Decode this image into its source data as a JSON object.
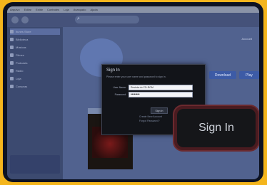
{
  "menubar": [
    "Arquivo",
    "Editar",
    "Exibir",
    "Controles",
    "Loja",
    "Avançado",
    "Ajuda"
  ],
  "sidebar": {
    "items": [
      {
        "label": "Itunes Store",
        "active": true
      },
      {
        "label": "Biblioteca",
        "active": false
      },
      {
        "label": "Músicas",
        "active": false
      },
      {
        "label": "Filmes",
        "active": false
      },
      {
        "label": "Podcasts",
        "active": false
      },
      {
        "label": "Rádio",
        "active": false
      },
      {
        "label": "Loja",
        "active": false
      },
      {
        "label": "Compras",
        "active": false
      }
    ]
  },
  "content": {
    "top_right": "Account",
    "download_label": "Download",
    "play_label": "Play"
  },
  "dialog": {
    "title": "Sign In",
    "description": "Please enter your user name and password to sign in.",
    "username_label": "User Name:",
    "username_value": "Revista do CD-ROM",
    "password_label": "Password:",
    "password_value": "••••••••",
    "sign_in_small": "Sign In",
    "link1": "Create New Account",
    "link2": "Forgot Password?"
  },
  "zoom": {
    "label": "Sign In"
  },
  "colors": {
    "background": "#f4b51c",
    "dialog": "#121419"
  }
}
